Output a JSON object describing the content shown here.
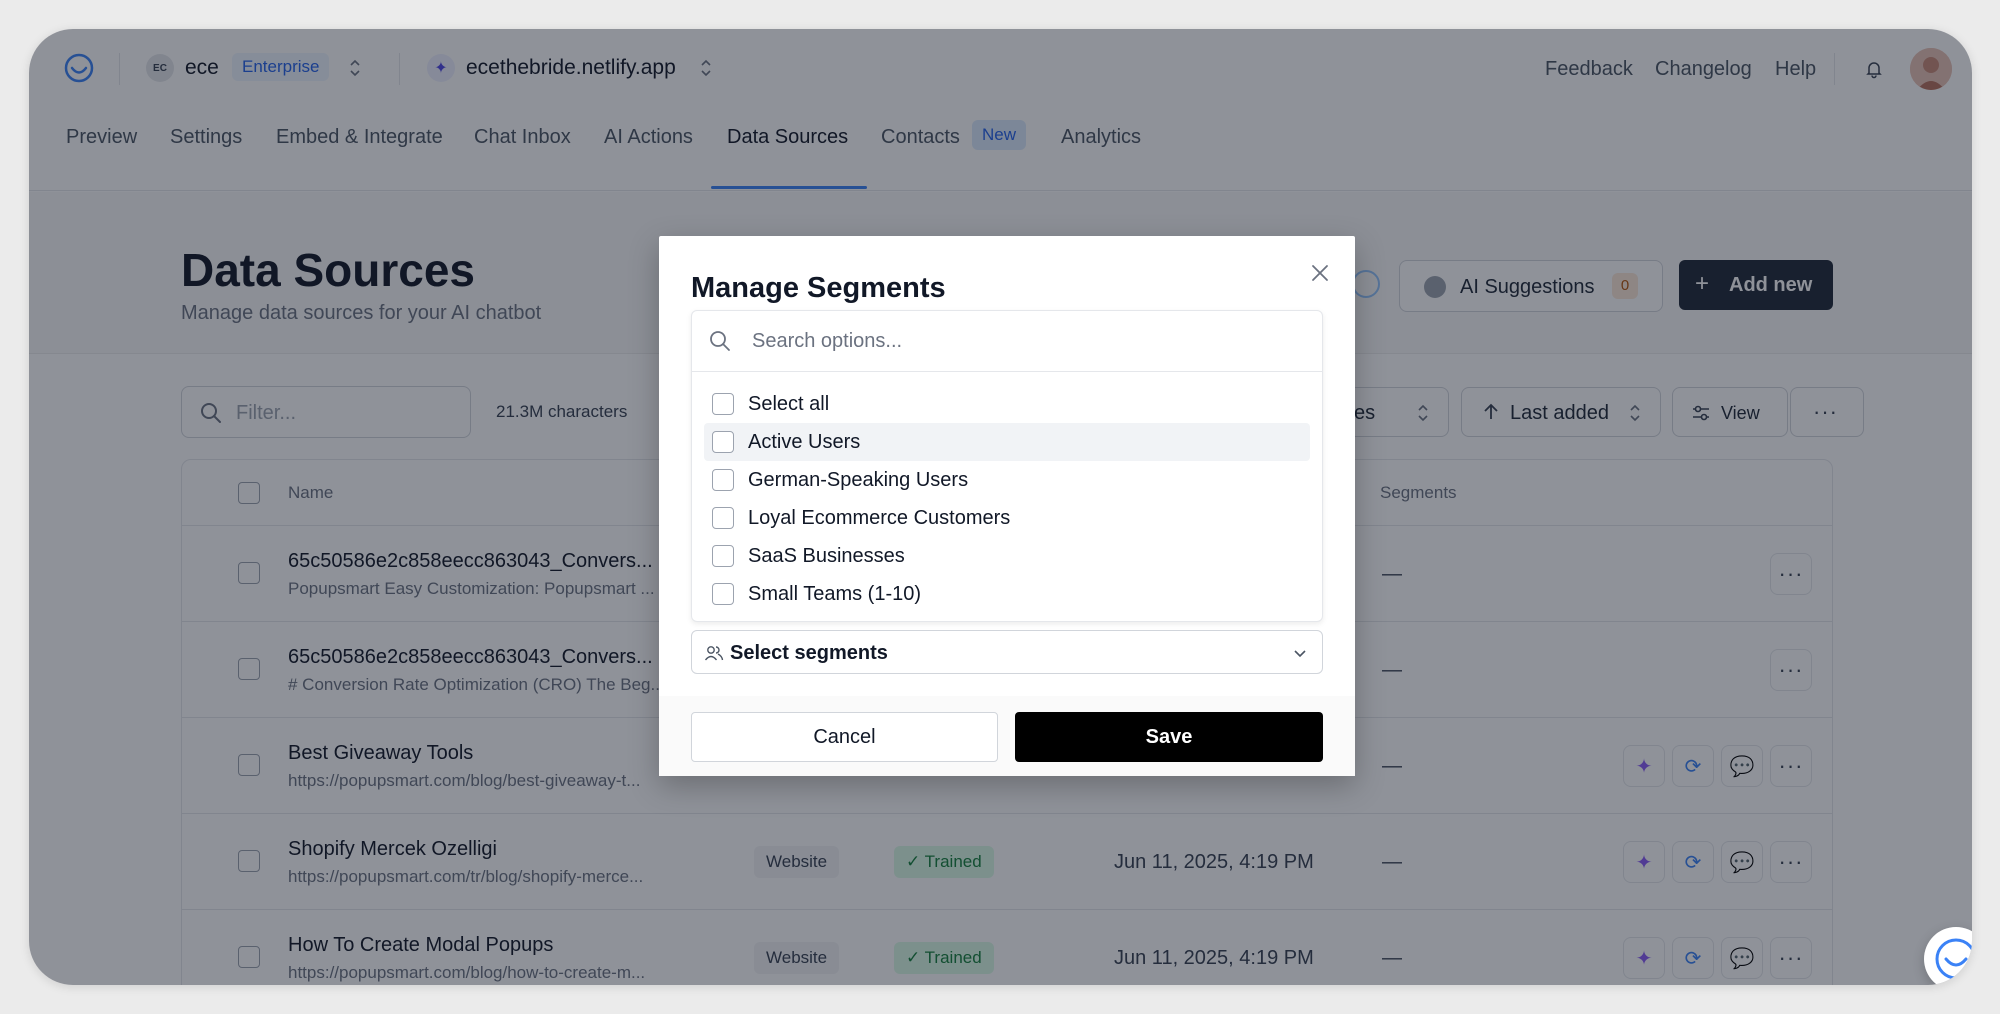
{
  "topbar": {
    "org_initials": "EC",
    "org_name": "ece",
    "plan": "Enterprise",
    "site_name": "ecethebride.netlify.app",
    "links": [
      "Feedback",
      "Changelog",
      "Help"
    ]
  },
  "tabs": [
    {
      "label": "Preview"
    },
    {
      "label": "Settings"
    },
    {
      "label": "Embed & Integrate"
    },
    {
      "label": "Chat Inbox"
    },
    {
      "label": "AI Actions"
    },
    {
      "label": "Data Sources",
      "active": true
    },
    {
      "label": "Contacts",
      "badge": "New"
    },
    {
      "label": "Analytics"
    }
  ],
  "page": {
    "title": "Data Sources",
    "subtitle": "Manage data sources for your AI chatbot",
    "ai_suggestions_label": "AI Suggestions",
    "ai_suggestions_count": "0",
    "add_new_label": "Add new"
  },
  "toolbar": {
    "filter_placeholder": "Filter...",
    "chars": "21.3M characters",
    "types_label_partial": "es",
    "sort_label": "Last added",
    "view_label": "View"
  },
  "table": {
    "headers": {
      "name": "Name",
      "segments": "Segments"
    },
    "rows": [
      {
        "name": "65c50586e2c858eecc863043_Convers...",
        "sub": "Popupsmart Easy Customization: Popupsmart ...",
        "type": "",
        "status": "",
        "date": "",
        "segments": "—"
      },
      {
        "name": "65c50586e2c858eecc863043_Convers...",
        "sub": "# Conversion Rate Optimization (CRO) The Beg...",
        "type": "",
        "status": "",
        "date": "",
        "segments": "—"
      },
      {
        "name": "Best Giveaway Tools",
        "sub": "https://popupsmart.com/blog/best-giveaway-t...",
        "type": "",
        "status": "",
        "date": "",
        "segments": "—"
      },
      {
        "name": "Shopify Mercek Ozelligi",
        "sub": "https://popupsmart.com/tr/blog/shopify-merce...",
        "type": "Website",
        "status": "Trained",
        "date": "Jun 11, 2025, 4:19 PM",
        "segments": "—"
      },
      {
        "name": "How To Create Modal Popups",
        "sub": "https://popupsmart.com/blog/how-to-create-m...",
        "type": "Website",
        "status": "Trained",
        "date": "Jun 11, 2025, 4:19 PM",
        "segments": "—"
      }
    ]
  },
  "modal": {
    "title": "Manage Segments",
    "search_placeholder": "Search options...",
    "options": [
      {
        "label": "Select all",
        "checked": false
      },
      {
        "label": "Active Users",
        "checked": false,
        "hover": true
      },
      {
        "label": "German-Speaking Users",
        "checked": false
      },
      {
        "label": "Loyal Ecommerce Customers",
        "checked": false
      },
      {
        "label": "SaaS Businesses",
        "checked": false
      },
      {
        "label": "Small Teams (1-10)",
        "checked": false
      }
    ],
    "select_label": "Select segments",
    "cancel_label": "Cancel",
    "save_label": "Save"
  },
  "colors": {
    "accent": "#3b82f6",
    "primary_button": "#1f2937",
    "save_button": "#000000",
    "trained_bg": "#dcfce7",
    "trained_text": "#15803d",
    "overlay": "rgba(17,24,39,0.47)"
  },
  "icons": {
    "logo": "smile-logo-icon",
    "bell": "bell-icon",
    "search": "search-icon",
    "close": "close-icon",
    "sparkle": "sparkle-icon",
    "refresh": "refresh-icon",
    "chat": "chat-icon",
    "more": "more-icon",
    "users": "users-icon"
  }
}
